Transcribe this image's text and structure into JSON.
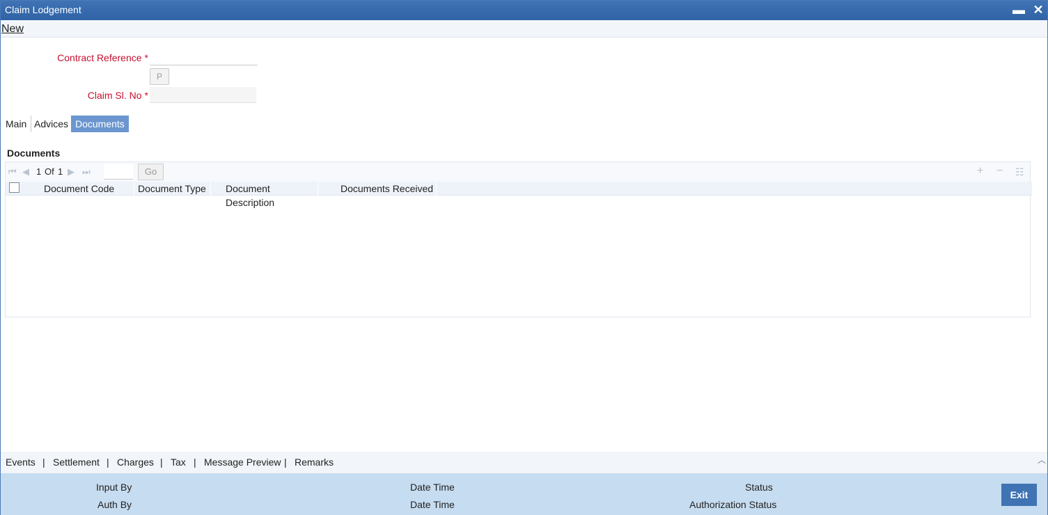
{
  "window": {
    "title": "Claim Lodgement",
    "minimize_glyph": "▬",
    "close_glyph": "✕"
  },
  "menu": {
    "new_label": "New"
  },
  "form": {
    "contract_reference": {
      "label": "Contract Reference",
      "required": "*",
      "value": ""
    },
    "p_button": "P",
    "claim_sl_no": {
      "label": "Claim Sl. No",
      "required": "*",
      "value": ""
    }
  },
  "tabs": [
    {
      "label": "Main",
      "active": false
    },
    {
      "label": "Advices",
      "active": false
    },
    {
      "label": "Documents",
      "active": true
    }
  ],
  "documents": {
    "section_title": "Documents",
    "pagination": {
      "current": "1",
      "of_label": "Of",
      "total": "1",
      "go_label": "Go",
      "page_input": ""
    },
    "icons": {
      "first": "first-page-icon",
      "prev": "prev-page-icon",
      "next": "next-page-icon",
      "last": "last-page-icon",
      "add": "add-row-icon",
      "remove": "delete-row-icon",
      "view": "single-view-icon"
    },
    "columns": [
      "Document Code",
      "Document Type",
      "Document Description",
      "Documents Received"
    ],
    "rows": []
  },
  "bottom_links": [
    "Events",
    "Settlement",
    "Charges",
    "Tax",
    "Message Preview",
    "Remarks"
  ],
  "footer": {
    "input_by": "Input By",
    "auth_by": "Auth By",
    "date_time_1": "Date Time",
    "date_time_2": "Date Time",
    "status": "Status",
    "authorization_status": "Authorization Status",
    "exit_label": "Exit"
  },
  "colors": {
    "titlebar": "#2f63a6",
    "active_tab": "#6b96cf",
    "footer": "#c6dcf0",
    "label_red": "#c5102f"
  }
}
